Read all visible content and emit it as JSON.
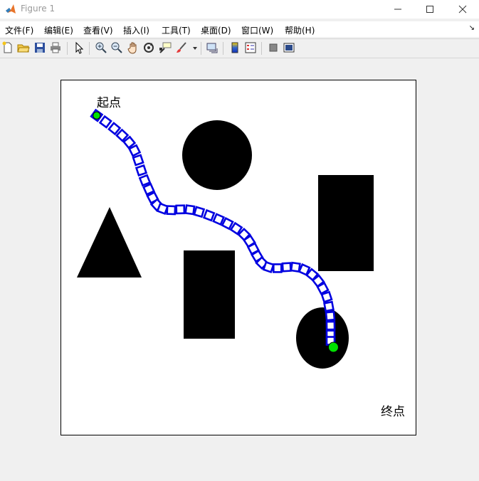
{
  "window": {
    "title": "Figure 1"
  },
  "menu": {
    "items": [
      "文件(F)",
      "编辑(E)",
      "查看(V)",
      "插入(I)",
      "工具(T)",
      "桌面(D)",
      "窗口(W)",
      "帮助(H)"
    ]
  },
  "toolbar": {
    "icons": [
      "new-figure-icon",
      "open-file-icon",
      "save-icon",
      "print-icon",
      "pointer-icon",
      "zoom-in-icon",
      "zoom-out-icon",
      "pan-hand-icon",
      "rotate-3d-icon",
      "data-cursor-icon",
      "brush-icon",
      "link-plot-icon",
      "colorbar-icon",
      "legend-icon",
      "hide-plot-tools-icon",
      "show-plot-tools-icon"
    ]
  },
  "figure": {
    "start_label": "起点",
    "end_label": "终点",
    "colors": {
      "path": "#0000e0",
      "start_marker": "#00e000",
      "end_marker": "#00e000",
      "obstacle": "#000000"
    },
    "path": {
      "points": [
        [
          0.1,
          0.099
        ],
        [
          0.125,
          0.117
        ],
        [
          0.15,
          0.136
        ],
        [
          0.172,
          0.155
        ],
        [
          0.192,
          0.175
        ],
        [
          0.207,
          0.198
        ],
        [
          0.217,
          0.225
        ],
        [
          0.226,
          0.254
        ],
        [
          0.236,
          0.282
        ],
        [
          0.247,
          0.307
        ],
        [
          0.258,
          0.331
        ],
        [
          0.27,
          0.351
        ],
        [
          0.286,
          0.362
        ],
        [
          0.31,
          0.366
        ],
        [
          0.336,
          0.364
        ],
        [
          0.363,
          0.365
        ],
        [
          0.389,
          0.371
        ],
        [
          0.417,
          0.381
        ],
        [
          0.444,
          0.392
        ],
        [
          0.469,
          0.404
        ],
        [
          0.494,
          0.418
        ],
        [
          0.516,
          0.435
        ],
        [
          0.531,
          0.454
        ],
        [
          0.542,
          0.475
        ],
        [
          0.553,
          0.496
        ],
        [
          0.566,
          0.515
        ],
        [
          0.585,
          0.527
        ],
        [
          0.61,
          0.53
        ],
        [
          0.636,
          0.527
        ],
        [
          0.661,
          0.527
        ],
        [
          0.686,
          0.534
        ],
        [
          0.708,
          0.548
        ],
        [
          0.725,
          0.566
        ],
        [
          0.738,
          0.587
        ],
        [
          0.749,
          0.611
        ],
        [
          0.755,
          0.638
        ],
        [
          0.759,
          0.665
        ],
        [
          0.76,
          0.692
        ],
        [
          0.76,
          0.717
        ],
        [
          0.76,
          0.735
        ]
      ]
    },
    "markers": {
      "start": [
        0.1,
        0.099
      ],
      "end": [
        0.768,
        0.753
      ]
    },
    "obstacles": [
      {
        "shape": "circle"
      },
      {
        "shape": "rectangle"
      },
      {
        "shape": "triangle"
      },
      {
        "shape": "rectangle"
      },
      {
        "shape": "ellipse"
      }
    ]
  }
}
